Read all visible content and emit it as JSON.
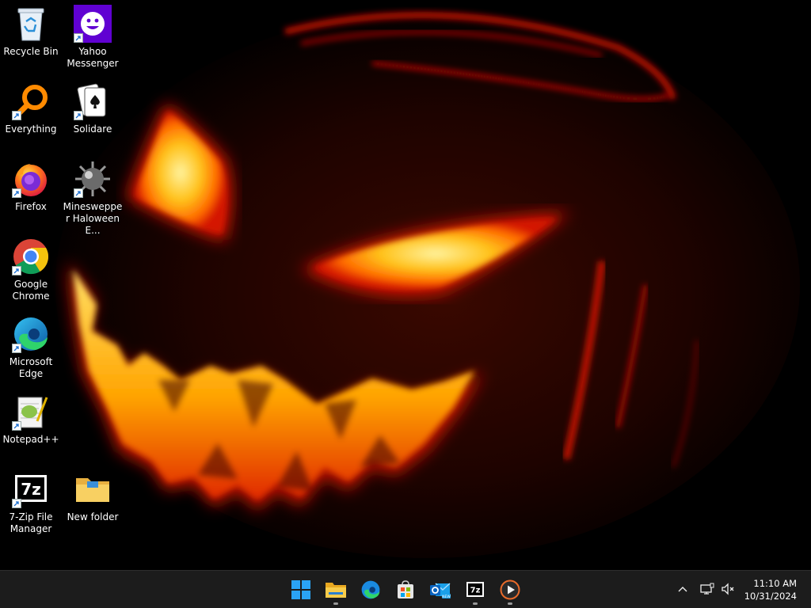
{
  "desktop_icons": [
    {
      "name": "recycle-bin",
      "label": "Recycle Bin"
    },
    {
      "name": "yahoo-messenger",
      "label": "Yahoo Messenger"
    },
    {
      "name": "everything",
      "label": "Everything"
    },
    {
      "name": "solidare",
      "label": "Solidare"
    },
    {
      "name": "firefox",
      "label": "Firefox"
    },
    {
      "name": "minesweeper",
      "label": "Mineswepper Haloween E..."
    },
    {
      "name": "google-chrome",
      "label": "Google Chrome"
    },
    {
      "name": "microsoft-edge",
      "label": "Microsoft Edge"
    },
    {
      "name": "notepad-plus-plus",
      "label": "Notepad++"
    },
    {
      "name": "7zip",
      "label": "7-Zip File Manager"
    },
    {
      "name": "new-folder",
      "label": "New folder"
    }
  ],
  "taskbar": {
    "apps": [
      {
        "name": "start",
        "icon": "windows-logo-icon"
      },
      {
        "name": "file-explorer",
        "icon": "folder-icon"
      },
      {
        "name": "edge",
        "icon": "edge-icon"
      },
      {
        "name": "store",
        "icon": "store-icon"
      },
      {
        "name": "outlook",
        "icon": "outlook-icon"
      },
      {
        "name": "7zip",
        "icon": "7zip-icon"
      },
      {
        "name": "media-player",
        "icon": "play-icon"
      }
    ],
    "tray": {
      "time": "11:10 AM",
      "date": "10/31/2024"
    }
  },
  "colors": {
    "taskbar_bg": "#1c1c1c",
    "pumpkin_glow": "#ff9a00",
    "pumpkin_edge": "#e01000",
    "windows_blue": "#2aa3f5"
  }
}
